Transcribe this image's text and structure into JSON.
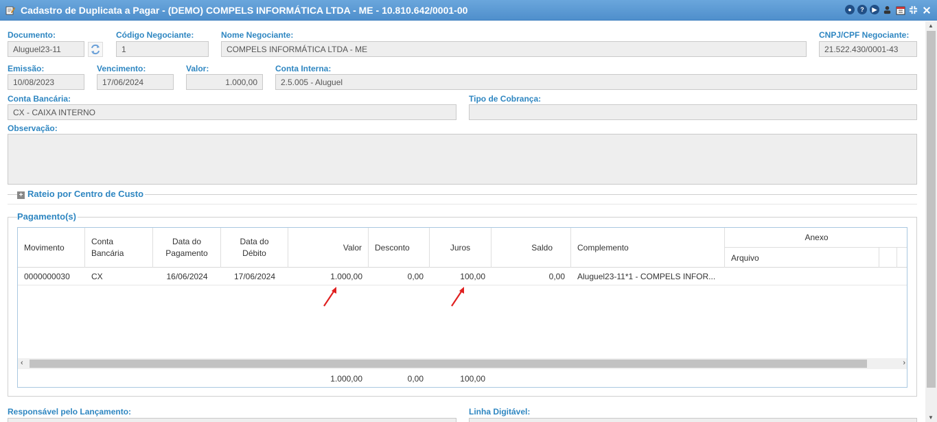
{
  "window": {
    "title": "Cadastro de Duplicata a Pagar - (DEMO) COMPELS INFORMÁTICA LTDA - ME - 10.810.642/0001-00",
    "tools": [
      "minimize-icon",
      "help-icon",
      "play-icon",
      "user-icon",
      "calendar-icon",
      "collapse-icon",
      "close-icon"
    ]
  },
  "form": {
    "documento": {
      "label": "Documento:",
      "value": "Aluguel23-11"
    },
    "codigo_negociante": {
      "label": "Código Negociante:",
      "value": "1"
    },
    "nome_negociante": {
      "label": "Nome Negociante:",
      "value": "COMPELS INFORMÁTICA LTDA - ME"
    },
    "cnpj_negociante": {
      "label": "CNPJ/CPF Negociante:",
      "value": "21.522.430/0001-43"
    },
    "emissao": {
      "label": "Emissão:",
      "value": "10/08/2023"
    },
    "vencimento": {
      "label": "Vencimento:",
      "value": "17/06/2024"
    },
    "valor": {
      "label": "Valor:",
      "value": "1.000,00"
    },
    "conta_interna": {
      "label": "Conta Interna:",
      "value": "2.5.005 - Aluguel"
    },
    "conta_bancaria": {
      "label": "Conta Bancária:",
      "value": "CX - CAIXA INTERNO"
    },
    "tipo_cobranca": {
      "label": "Tipo de Cobrança:",
      "value": ""
    },
    "observacao": {
      "label": "Observação:",
      "value": ""
    },
    "responsavel": {
      "label": "Responsável pelo Lançamento:"
    },
    "linha_digitavel": {
      "label": "Linha Digitável:"
    }
  },
  "rateio": {
    "title": "Rateio por Centro de Custo"
  },
  "pagamentos": {
    "title": "Pagamento(s)",
    "columns": {
      "movimento": "Movimento",
      "conta_bancaria": "Conta Bancária",
      "data_pagamento": "Data do Pagamento",
      "data_debito": "Data do Débito",
      "valor": "Valor",
      "desconto": "Desconto",
      "juros": "Juros",
      "saldo": "Saldo",
      "complemento": "Complemento",
      "anexo": "Anexo",
      "arquivo": "Arquivo"
    },
    "rows": [
      {
        "movimento": "0000000030",
        "conta_bancaria": "CX",
        "data_pagamento": "16/06/2024",
        "data_debito": "17/06/2024",
        "valor": "1.000,00",
        "desconto": "0,00",
        "juros": "100,00",
        "saldo": "0,00",
        "complemento": "Aluguel23-11*1 - COMPELS INFOR..."
      }
    ],
    "totals": {
      "valor": "1.000,00",
      "desconto": "0,00",
      "juros": "100,00"
    }
  },
  "colors": {
    "accent": "#2e86c1",
    "titlebar": "#5b9bd5",
    "arrow": "#e02020"
  }
}
